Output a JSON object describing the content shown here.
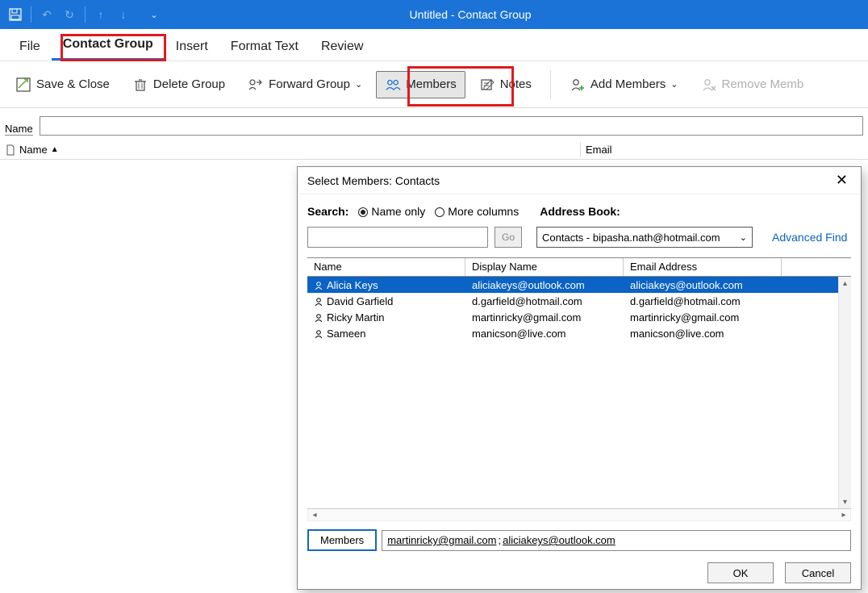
{
  "titlebar": {
    "title": "Untitled  -  Contact Group"
  },
  "tabs": {
    "file": "File",
    "contact_group": "Contact Group",
    "insert": "Insert",
    "format_text": "Format Text",
    "review": "Review"
  },
  "ribbon": {
    "save_close": "Save & Close",
    "delete_group": "Delete Group",
    "forward_group": "Forward Group",
    "members": "Members",
    "notes": "Notes",
    "add_members": "Add Members",
    "remove_members": "Remove Memb"
  },
  "name_row": {
    "label": "Name"
  },
  "list_header": {
    "name": "Name",
    "email": "Email"
  },
  "dialog": {
    "title": "Select Members: Contacts",
    "search_label": "Search:",
    "radio_name_only": "Name only",
    "radio_more_cols": "More columns",
    "address_book_label": "Address Book:",
    "go": "Go",
    "combo_value": "Contacts - bipasha.nath@hotmail.com",
    "advanced_find": "Advanced Find",
    "headers": {
      "name": "Name",
      "display": "Display Name",
      "email": "Email Address"
    },
    "rows": [
      {
        "name": "Alicia Keys",
        "display": "aliciakeys@outlook.com",
        "email": "aliciakeys@outlook.com",
        "selected": true
      },
      {
        "name": "David Garfield",
        "display": "d.garfield@hotmail.com",
        "email": "d.garfield@hotmail.com",
        "selected": false
      },
      {
        "name": "Ricky Martin",
        "display": "martinricky@gmail.com",
        "email": "martinricky@gmail.com",
        "selected": false
      },
      {
        "name": "Sameen",
        "display": "manicson@live.com",
        "email": "manicson@live.com",
        "selected": false
      }
    ],
    "members_btn": "Members",
    "members_value": [
      "martinricky@gmail.com",
      "aliciakeys@outlook.com"
    ],
    "ok": "OK",
    "cancel": "Cancel"
  }
}
